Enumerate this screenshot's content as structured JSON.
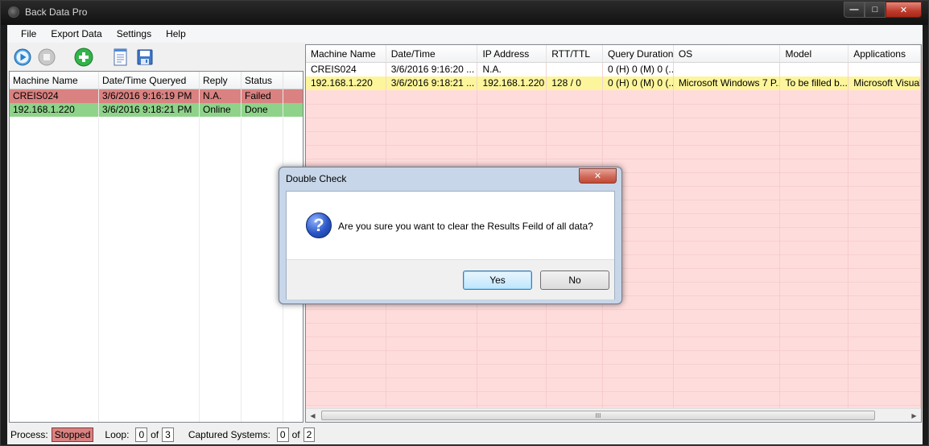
{
  "window": {
    "title": "Back Data Pro"
  },
  "menu": [
    "File",
    "Export Data",
    "Settings",
    "Help"
  ],
  "toolbar": {
    "icons": [
      "play-icon",
      "stop-icon",
      "add-icon",
      "notepad-icon",
      "save-icon"
    ]
  },
  "left_grid": {
    "columns": [
      "Machine Name",
      "Date/Time Queryed",
      "Reply",
      "Status"
    ],
    "rows": [
      {
        "status": "failed",
        "cells": [
          "CREIS024",
          "3/6/2016 9:16:19 PM",
          "N.A.",
          "Failed"
        ]
      },
      {
        "status": "done",
        "cells": [
          "192.168.1.220",
          "3/6/2016 9:18:21 PM",
          "Online",
          "Done"
        ]
      }
    ]
  },
  "right_grid": {
    "columns": [
      "Machine Name",
      "Date/Time",
      "IP Address",
      "RTT/TTL",
      "Query Duration",
      "OS",
      "Model",
      "Applications"
    ],
    "rows": [
      {
        "style": "plain",
        "cells": [
          "CREIS024",
          "3/6/2016 9:16:20 ...",
          "N.A.",
          "",
          "0 (H) 0 (M) 0 (...",
          "",
          "",
          ""
        ]
      },
      {
        "style": "yellow",
        "cells": [
          "192.168.1.220",
          "3/6/2016 9:18:21 ...",
          "192.168.1.220",
          "128 / 0",
          "0 (H) 0 (M) 0 (...",
          "Microsoft Windows 7 P...",
          "To be filled b...",
          "Microsoft Visual S"
        ]
      }
    ],
    "scroll_grip": "III"
  },
  "statusbar": {
    "process_label": "Process:",
    "process_value": "Stopped",
    "loop_label": "Loop:",
    "loop_value": "0",
    "loop_of": "of",
    "loop_total": "3",
    "captured_label": "Captured Systems:",
    "captured_value": "0",
    "captured_of": "of",
    "captured_total": "2"
  },
  "dialog": {
    "title": "Double Check",
    "message": "Are you sure you want to clear the Results Feild of all data?",
    "yes_label": "Yes",
    "no_label": "No",
    "icon": "question-icon"
  },
  "colors": {
    "failed_row": "#d98281",
    "done_row": "#8fd38a",
    "yellow_row": "#fdf59b",
    "results_background": "#ffdcdc"
  }
}
